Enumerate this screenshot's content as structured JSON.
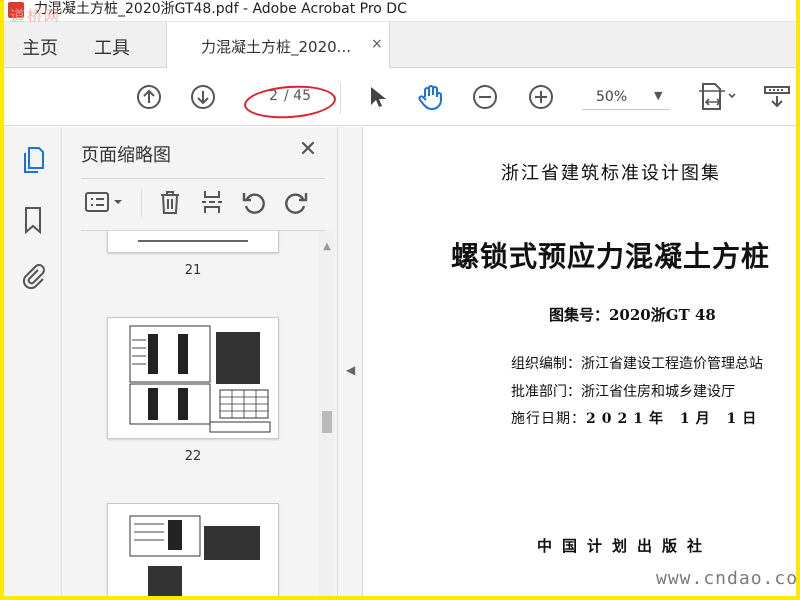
{
  "window": {
    "title": "力混凝土方桩_2020浙GT48.pdf - Adobe Acrobat Pro DC",
    "watermark_top": "道桥网"
  },
  "menubar": {
    "home": "主页",
    "tools": "工具",
    "doc_tab_label": "力混凝土方桩_2020...",
    "doc_tab_close": "×"
  },
  "toolbar": {
    "page_current": "2",
    "page_total": "/ 45",
    "zoom": "50%",
    "icons": [
      "arrow-up-circle-icon",
      "arrow-down-circle-icon",
      "select-pointer-icon",
      "hand-icon",
      "zoom-out-icon",
      "zoom-in-icon",
      "page-display-icon",
      "scroll-mode-icon"
    ]
  },
  "colors": {
    "accent": "#1a73d9",
    "annotation": "#e0202a",
    "outer_border": "#ffe900"
  },
  "thumbnail_panel": {
    "title": "页面缩略图",
    "close": "✕",
    "thumbnails": [
      {
        "label": "21"
      },
      {
        "label": "22"
      },
      {
        "label": ""
      }
    ]
  },
  "document": {
    "series": "浙江省建筑标准设计图集",
    "title": "螺锁式预应力混凝土方桩",
    "code": "图集号：2020浙GT 48",
    "org": "组织编制：浙江省建设工程造价管理总站",
    "approve": "批准部门：浙江省住房和城乡建设厅",
    "date_label": "施行日期：",
    "date_value": "2021年 1月 1日",
    "publisher": "中国计划出版社"
  },
  "site_watermark": "www.cndao.com"
}
